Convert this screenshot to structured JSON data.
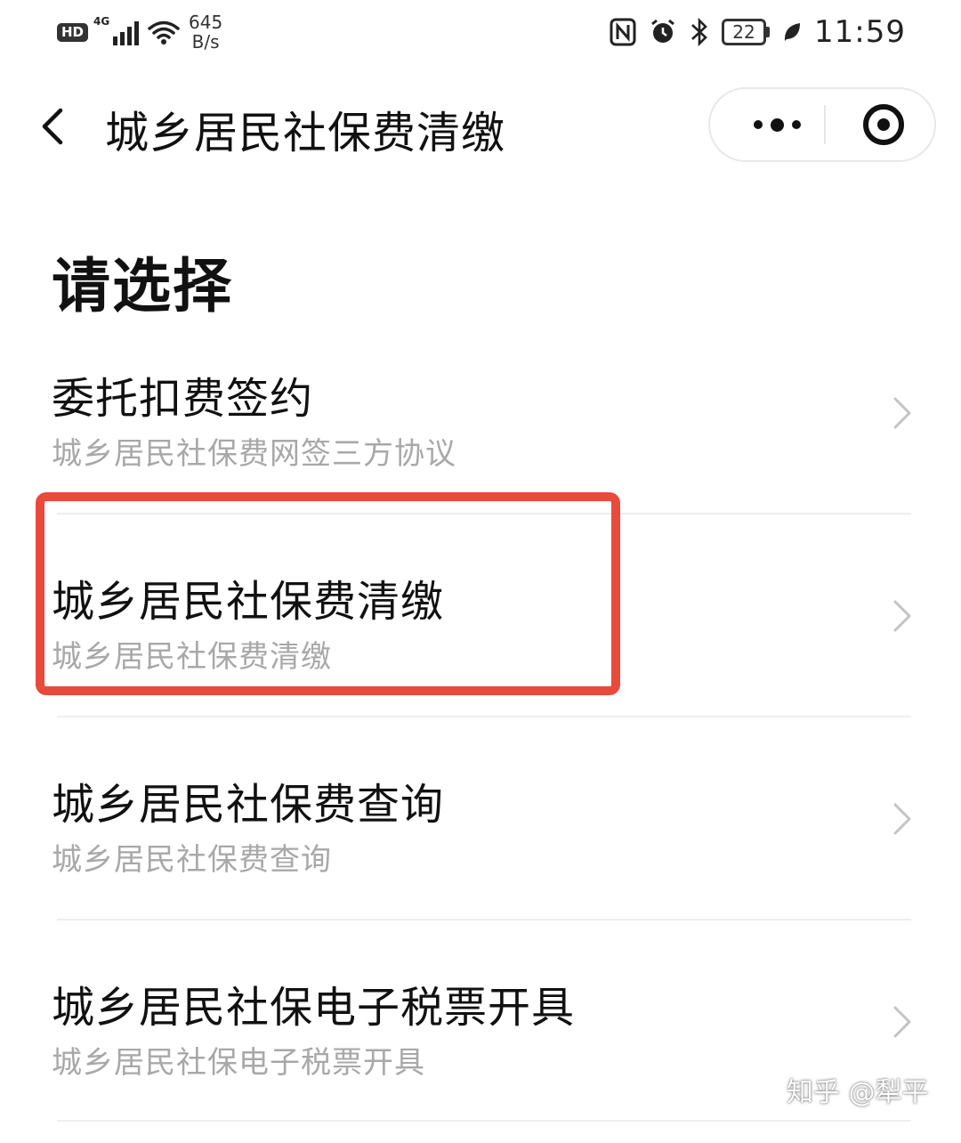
{
  "status_bar": {
    "hd_label": "HD",
    "network_label": "4G",
    "speed_value": "645",
    "speed_unit": "B/s",
    "battery_level": "22",
    "time": "11:59",
    "icons": [
      "nfc-icon",
      "alarm-icon",
      "bluetooth-icon",
      "battery-icon",
      "leaf-icon"
    ]
  },
  "nav": {
    "title": "城乡居民社保费清缴",
    "back_icon": "chevron-left-icon",
    "more_icon": "more-dots-icon",
    "close_icon": "target-close-icon"
  },
  "page": {
    "heading": "请选择"
  },
  "menu": {
    "items": [
      {
        "title": "委托扣费签约",
        "subtitle": "城乡居民社保费网签三方协议"
      },
      {
        "title": "城乡居民社保费清缴",
        "subtitle": "城乡居民社保费清缴"
      },
      {
        "title": "城乡居民社保费查询",
        "subtitle": "城乡居民社保费查询"
      },
      {
        "title": "城乡居民社保电子税票开具",
        "subtitle": "城乡居民社保电子税票开具"
      }
    ]
  },
  "annotation": {
    "highlight_color": "#e84a3b",
    "highlighted_item": "城乡居民社保费清缴"
  },
  "watermark": {
    "text": "知乎 @犁平"
  }
}
